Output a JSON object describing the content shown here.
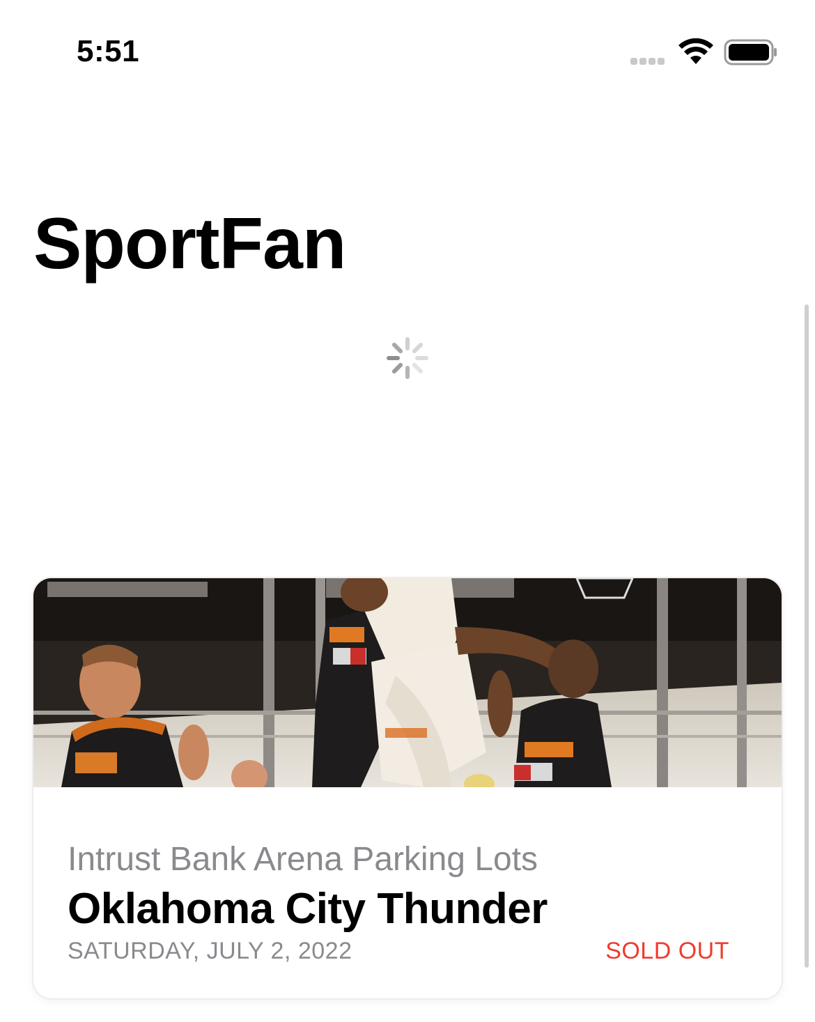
{
  "status_bar": {
    "time": "5:51",
    "icons": [
      "signal-dots-icon",
      "wifi-icon",
      "battery-icon"
    ]
  },
  "app": {
    "title": "SportFan"
  },
  "loading": {
    "icon": "spinner-icon",
    "spinner_color": "#9b9b9b"
  },
  "events": [
    {
      "image": "basketball-action-photo",
      "venue": "Intrust Bank Arena Parking Lots",
      "team": "Oklahoma City Thunder",
      "date": "SATURDAY, JULY 2, 2022",
      "status": "SOLD OUT",
      "status_color": "#ef3b2f"
    }
  ],
  "colors": {
    "background": "#ffffff",
    "secondary_text": "#8a8a8e",
    "primary_text": "#000000",
    "accent_red": "#ef3b2f"
  }
}
